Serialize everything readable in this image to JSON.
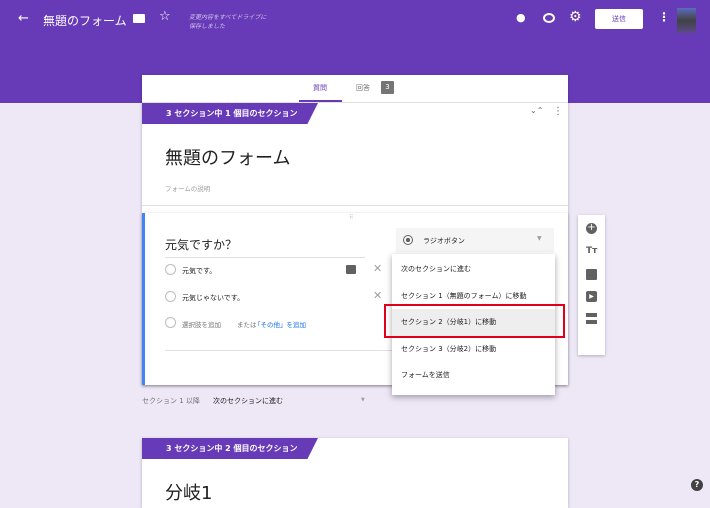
{
  "header": {
    "title": "無題のフォーム",
    "save_status_line1": "変更内容をすべてドライブに",
    "save_status_line2": "保存しました",
    "send_label": "送信"
  },
  "tabs": [
    {
      "label": "質問"
    },
    {
      "label": "回答",
      "badge": "3"
    }
  ],
  "section1": {
    "label": "3 セクション中 1 個目のセクション",
    "title": "無題のフォーム",
    "description_placeholder": "フォームの説明"
  },
  "question": {
    "title": "元気ですか？",
    "type": "ラジオボタン",
    "options": [
      "元気です。",
      "元気じゃないです。"
    ],
    "add_option": "選択肢を追加",
    "or": "または",
    "add_other": "「その他」を追加"
  },
  "menu": {
    "items": [
      "次のセクションに進む",
      "セクション 1（無題のフォーム）に移動",
      "セクション 2（分岐1）に移動",
      "セクション 3（分岐2）に移動",
      "フォームを送信"
    ],
    "selected_index": 2
  },
  "after_section": {
    "label": "セクション 1 以降",
    "value": "次のセクションに進む"
  },
  "section2": {
    "label": "3 セクション中 2 個目のセクション",
    "title": "分岐1"
  },
  "colors": {
    "primary": "#673ab7",
    "background": "#ede7f6",
    "highlight": "#e0001b",
    "link": "#1a73e8"
  }
}
